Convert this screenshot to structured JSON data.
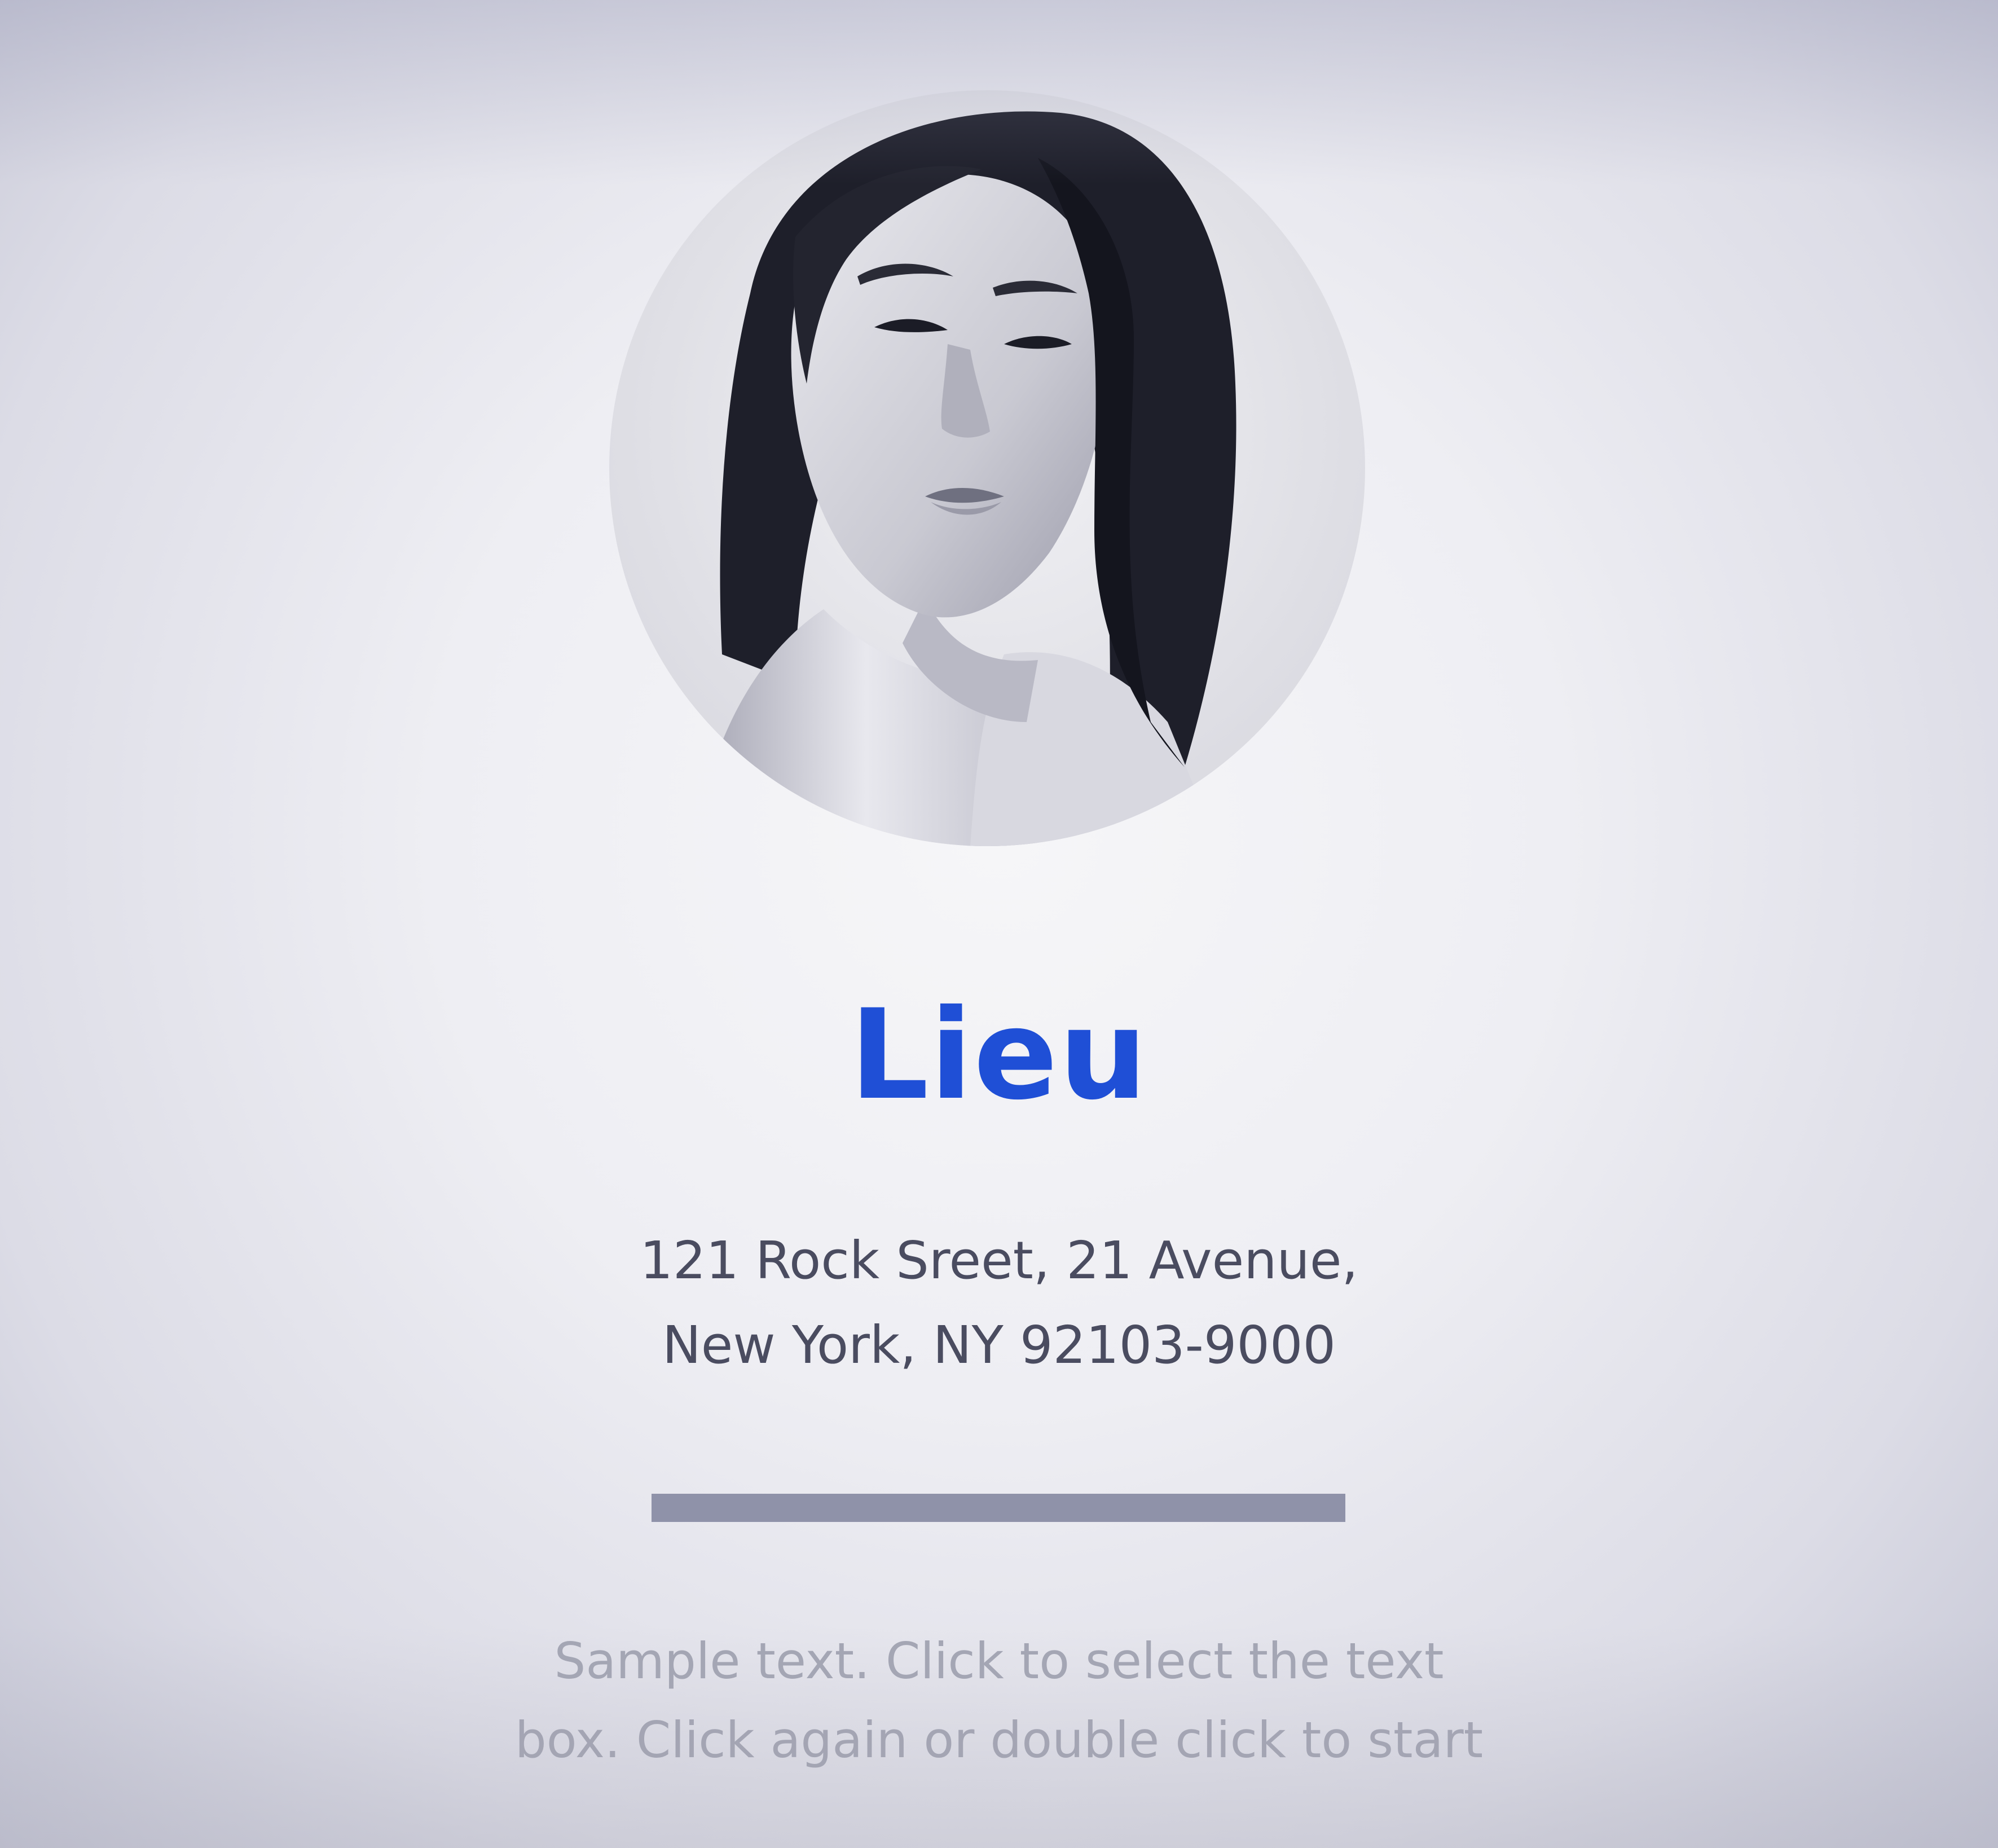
{
  "profile": {
    "photo_icon": "portrait-photo",
    "name": "Lieu",
    "address_line1": "121 Rock Sreet, 21 Avenue,",
    "address_line2": "New York, NY 92103-9000"
  },
  "sample_text": {
    "line1": "Sample text. Click to select the text",
    "line2": "box. Click again or double click to start"
  },
  "colors": {
    "name": "#1f4fd6",
    "divider": "#8f92a9",
    "address_text": "#4a4c60",
    "sample_text": "#a4a6b4"
  }
}
